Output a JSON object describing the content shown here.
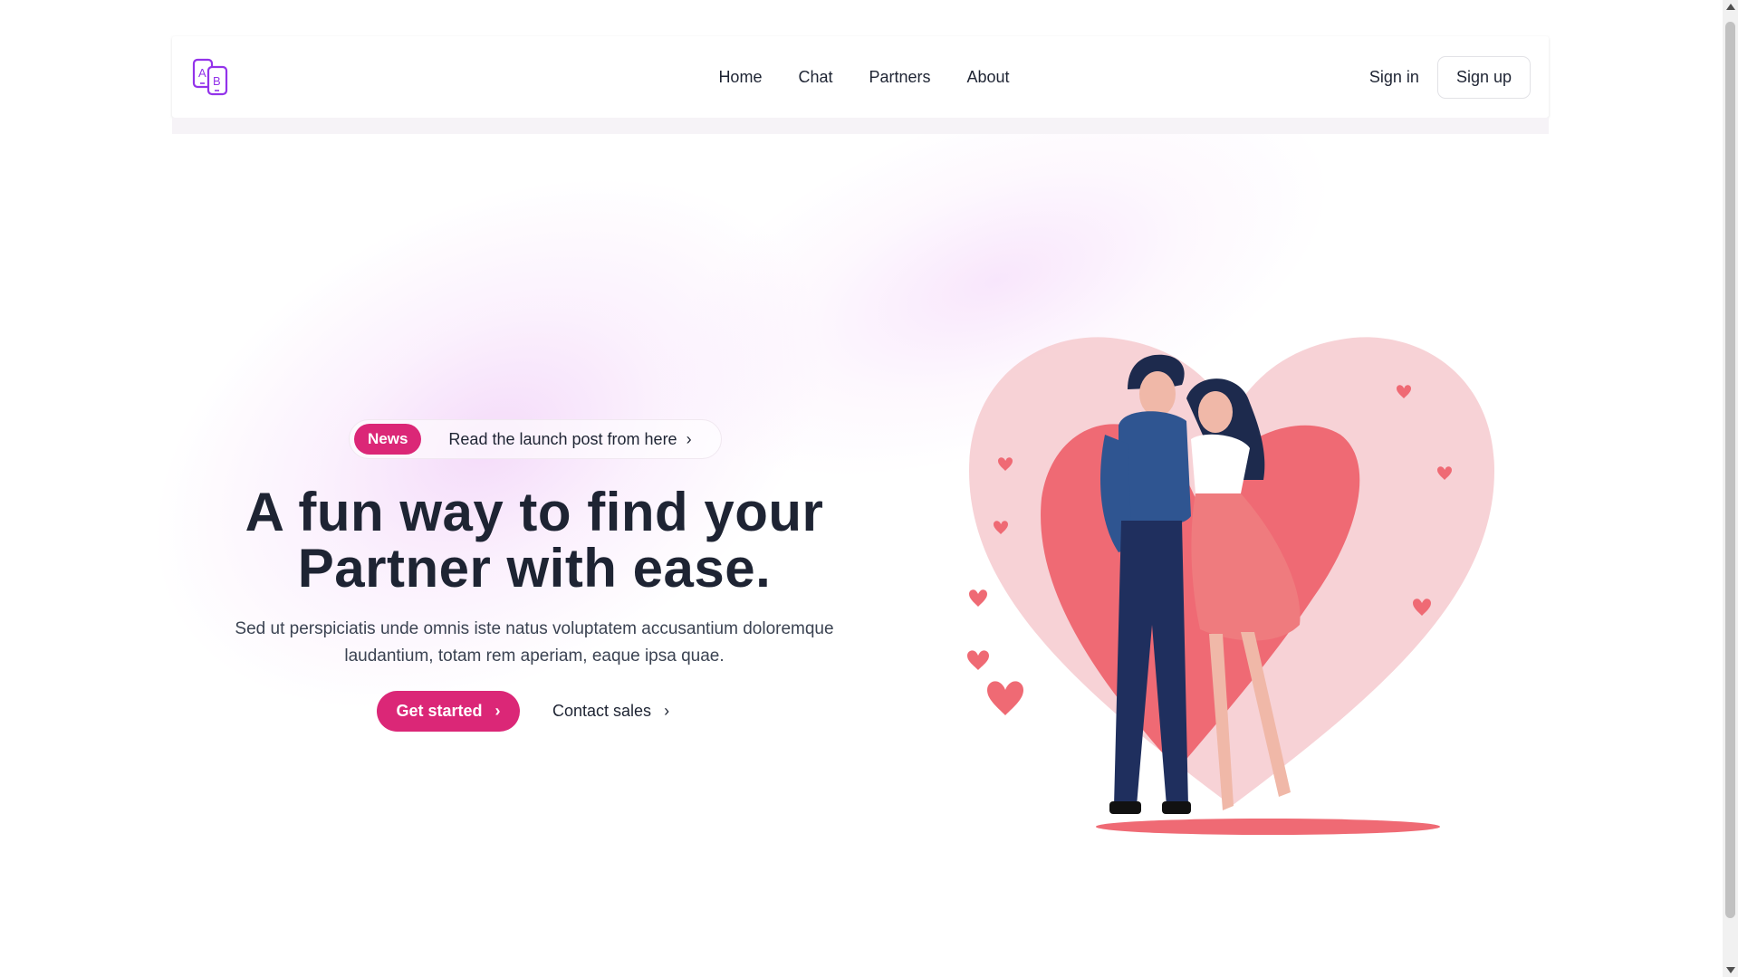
{
  "nav": {
    "logo_name": "ab-chat-logo",
    "items": [
      {
        "label": "Home"
      },
      {
        "label": "Chat"
      },
      {
        "label": "Partners"
      },
      {
        "label": "About"
      }
    ],
    "sign_in": "Sign in",
    "sign_up": "Sign up"
  },
  "announcement": {
    "badge": "News",
    "text": "Read the launch post from here",
    "chevron": "›"
  },
  "hero": {
    "headline_line1": "A fun way to find your",
    "headline_line2": "Partner with ease.",
    "subtitle": "Sed ut perspiciatis unde omnis iste natus voluptatem accusantium doloremque laudantium, totam rem aperiam, eaque ipsa quae.",
    "primary_cta": "Get started",
    "secondary_cta": "Contact sales",
    "chevron": "›"
  },
  "illustration": {
    "subject": "couple-embracing-heart-illustration"
  },
  "colors": {
    "accent": "#db2777",
    "logo": "#9333ea",
    "text": "#1e2433",
    "heart_light": "#f5c4c9",
    "heart_main": "#ef6a74"
  }
}
